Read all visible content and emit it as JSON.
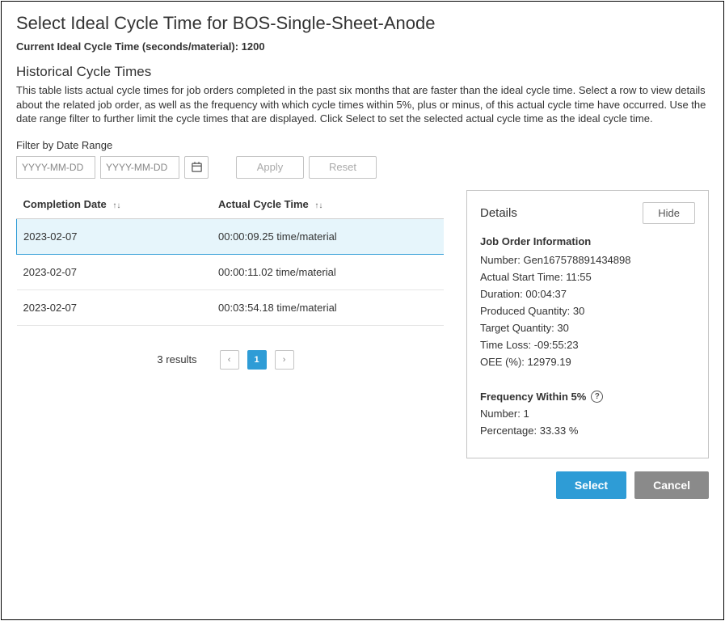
{
  "title": "Select Ideal Cycle Time for BOS-Single-Sheet-Anode",
  "current_cycle_label": "Current Ideal Cycle Time (seconds/material): 1200",
  "historical_head": "Historical Cycle Times",
  "description": "This table lists actual cycle times for job orders completed in the past six months that are faster than the ideal cycle time. Select a row to view details about the related job order, as well as the frequency with which cycle times within 5%, plus or minus, of this actual cycle time have occurred. Use the date range filter to further limit the cycle times that are displayed. Click Select to set the selected actual cycle time as the ideal cycle time.",
  "filter": {
    "label": "Filter by Date Range",
    "from_placeholder": "YYYY-MM-DD",
    "to_placeholder": "YYYY-MM-DD",
    "apply": "Apply",
    "reset": "Reset"
  },
  "table": {
    "col_date": "Completion Date",
    "col_cycle": "Actual Cycle Time",
    "rows": [
      {
        "date": "2023-02-07",
        "cycle": "00:00:09.25 time/material",
        "selected": true
      },
      {
        "date": "2023-02-07",
        "cycle": "00:00:11.02 time/material",
        "selected": false
      },
      {
        "date": "2023-02-07",
        "cycle": "00:03:54.18 time/material",
        "selected": false
      }
    ]
  },
  "pager": {
    "results": "3  results",
    "page": "1"
  },
  "details": {
    "title": "Details",
    "hide": "Hide",
    "job_head": "Job Order Information",
    "number": "Number: Gen167578891434898",
    "start": "Actual Start Time: 11:55",
    "duration": "Duration: 00:04:37",
    "produced": "Produced Quantity: 30",
    "target": "Target Quantity: 30",
    "timeloss": "Time Loss: -09:55:23",
    "oee": "OEE (%): 12979.19",
    "freq_head": "Frequency Within 5%",
    "freq_number": "Number: 1",
    "freq_pct": "Percentage: 33.33 %"
  },
  "footer": {
    "select": "Select",
    "cancel": "Cancel"
  }
}
